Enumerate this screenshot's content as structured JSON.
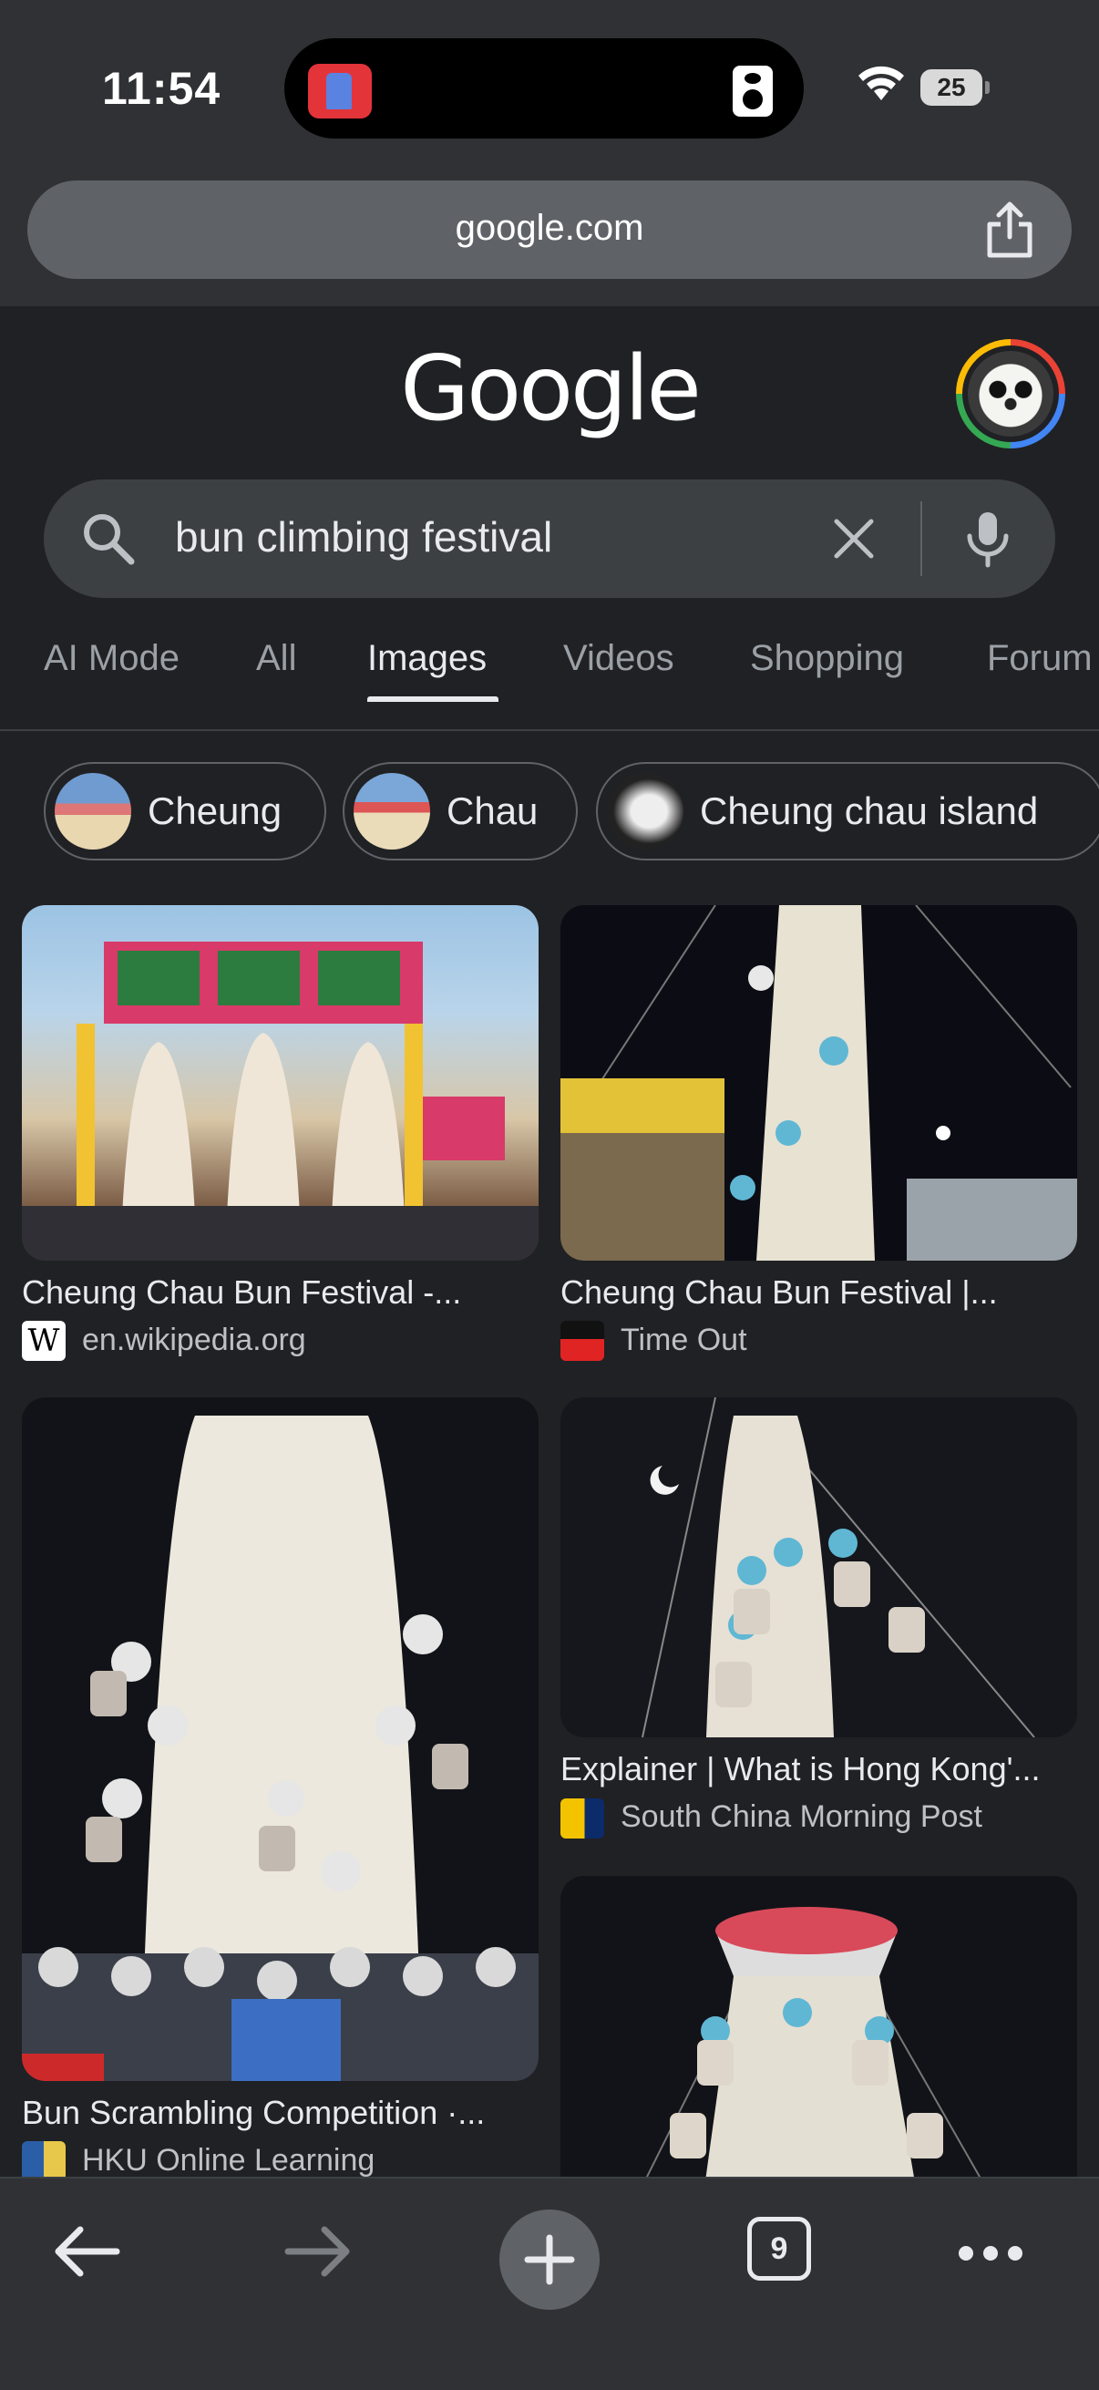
{
  "status_bar": {
    "time": "11:54",
    "battery": "25"
  },
  "browser": {
    "url": "google.com"
  },
  "google": {
    "logo": "Google",
    "query": "bun climbing festival"
  },
  "tabs": [
    {
      "label": "AI Mode",
      "active": false
    },
    {
      "label": "All",
      "active": false
    },
    {
      "label": "Images",
      "active": true
    },
    {
      "label": "Videos",
      "active": false
    },
    {
      "label": "Shopping",
      "active": false
    },
    {
      "label": "Forum",
      "active": false
    }
  ],
  "chips": [
    {
      "label": "Cheung"
    },
    {
      "label": "Chau"
    },
    {
      "label": "Cheung chau island"
    }
  ],
  "results": [
    {
      "title": "Cheung Chau Bun Festival -...",
      "source": "en.wikipedia.org",
      "favicon": "W"
    },
    {
      "title": "Cheung Chau Bun Festival |...",
      "source": "Time Out",
      "favicon": ""
    },
    {
      "title": "Bun Scrambling Competition ·...",
      "source": "HKU Online Learning",
      "favicon": ""
    },
    {
      "title": "Explainer | What is Hong Kong'...",
      "source": "South China Morning Post",
      "favicon": ""
    }
  ],
  "toolbar": {
    "tab_count": "9"
  },
  "colors": {
    "page_bg": "#202124",
    "chrome_bg": "#303134",
    "search_bg": "#3c4043",
    "text": "#e8eaed",
    "muted": "#9aa0a6"
  }
}
